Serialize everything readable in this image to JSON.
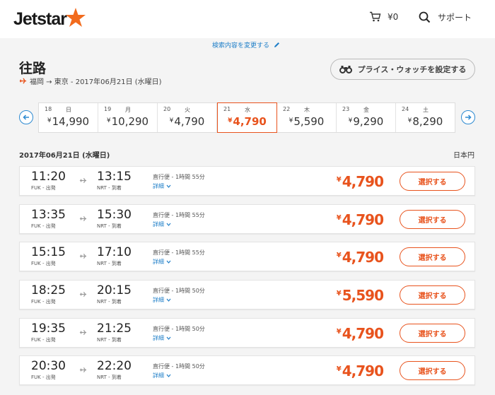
{
  "header": {
    "logo_text": "Jetstar",
    "cart_amount": "¥0",
    "support_label": "サポート"
  },
  "search": {
    "change_label": "検索内容を変更する"
  },
  "trip": {
    "title": "往路",
    "route": "福岡 → 東京 - 2017年06月21日 (水曜日)",
    "price_watch_label": "プライス・ウォッチを設定する"
  },
  "date_strip": {
    "currency_symbol": "¥",
    "days": [
      {
        "day": "18",
        "weekday": "日",
        "price": "14,990"
      },
      {
        "day": "19",
        "weekday": "月",
        "price": "10,290"
      },
      {
        "day": "20",
        "weekday": "火",
        "price": "4,790"
      },
      {
        "day": "21",
        "weekday": "水",
        "price": "4,790",
        "selected": true
      },
      {
        "day": "22",
        "weekday": "木",
        "price": "5,590"
      },
      {
        "day": "23",
        "weekday": "金",
        "price": "9,290"
      },
      {
        "day": "24",
        "weekday": "土",
        "price": "8,290"
      }
    ]
  },
  "results": {
    "date_label": "2017年06月21日 (水曜日)",
    "currency_label": "日本円",
    "detail_label": "詳細",
    "select_label": "選択する",
    "flights": [
      {
        "dep_time": "11:20",
        "dep_sub": "FUK - 出発",
        "arr_time": "13:15",
        "arr_sub": "NRT - 到着",
        "info": "直行便 - 1時間 55分",
        "price": "4,790"
      },
      {
        "dep_time": "13:35",
        "dep_sub": "FUK - 出発",
        "arr_time": "15:30",
        "arr_sub": "NRT - 到着",
        "info": "直行便 - 1時間 55分",
        "price": "4,790"
      },
      {
        "dep_time": "15:15",
        "dep_sub": "FUK - 出発",
        "arr_time": "17:10",
        "arr_sub": "NRT - 到着",
        "info": "直行便 - 1時間 55分",
        "price": "4,790"
      },
      {
        "dep_time": "18:25",
        "dep_sub": "FUK - 出発",
        "arr_time": "20:15",
        "arr_sub": "NRT - 到着",
        "info": "直行便 - 1時間 50分",
        "price": "5,590"
      },
      {
        "dep_time": "19:35",
        "dep_sub": "FUK - 出発",
        "arr_time": "21:25",
        "arr_sub": "NRT - 到着",
        "info": "直行便 - 1時間 50分",
        "price": "4,790"
      },
      {
        "dep_time": "20:30",
        "dep_sub": "FUK - 出発",
        "arr_time": "22:20",
        "arr_sub": "NRT - 到着",
        "info": "直行便 - 1時間 50分",
        "price": "4,790"
      }
    ]
  },
  "colors": {
    "accent": "#e8531d",
    "link": "#1f7fc8"
  }
}
